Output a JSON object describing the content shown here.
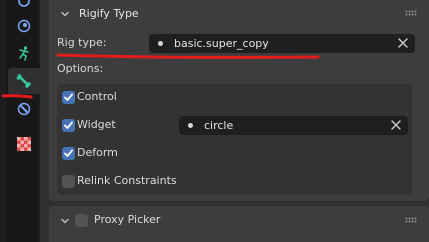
{
  "tabs": [
    {
      "icon": "constraint-icon",
      "active": false
    },
    {
      "icon": "physics-icon",
      "active": false
    },
    {
      "icon": "object-data-icon",
      "active": false
    },
    {
      "icon": "bone-icon",
      "active": true
    },
    {
      "icon": "bone-constraint-icon",
      "active": false
    },
    {
      "icon": "texture-icon",
      "active": false
    }
  ],
  "rigify_panel": {
    "title": "Rigify Type",
    "rig_type_label": "Rig type:",
    "rig_type_value": "basic.super_copy",
    "options_label": "Options:",
    "options": [
      {
        "label": "Control",
        "checked": true
      },
      {
        "label": "Widget",
        "checked": true
      },
      {
        "label": "Deform",
        "checked": true
      },
      {
        "label": "Relink Constraints",
        "checked": false
      }
    ],
    "widget_value": "circle"
  },
  "proxy_panel": {
    "title": "Proxy Picker",
    "enabled": false
  },
  "colors": {
    "accent": "#4772b3",
    "annotation_red": "#e21b1b",
    "bone_green": "#36c9a0"
  }
}
